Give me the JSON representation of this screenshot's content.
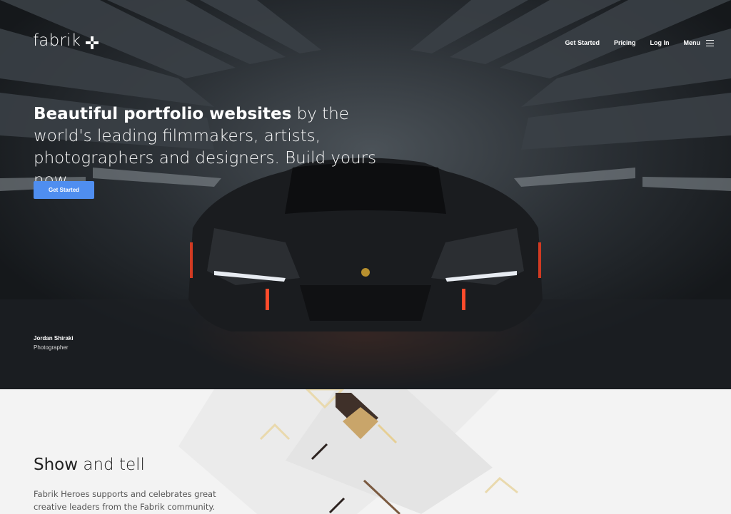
{
  "header": {
    "logo_text": "fabrik",
    "logo_icon": "fabrik-cross-icon",
    "nav": {
      "get_started": "Get Started",
      "pricing": "Pricing",
      "log_in": "Log In",
      "menu": "Menu"
    }
  },
  "hero": {
    "headline_bold": "Beautiful portfolio websites",
    "headline_rest": " by the world's leading filmmakers, artists, photographers and designers. Build yours now.",
    "cta_label": "Get Started",
    "credit_name": "Jordan Shiraki",
    "credit_role": "Photographer",
    "image": "sports-car-in-concrete-tunnel"
  },
  "section": {
    "title_bold": "Show",
    "title_rest": " and tell",
    "text": "Fabrik Heroes supports and celebrates great creative leaders from the Fabrik community."
  },
  "colors": {
    "cta": "#4f8ef0",
    "accent_gold": "#c8a36a",
    "accent_brown": "#4a3a2e"
  }
}
